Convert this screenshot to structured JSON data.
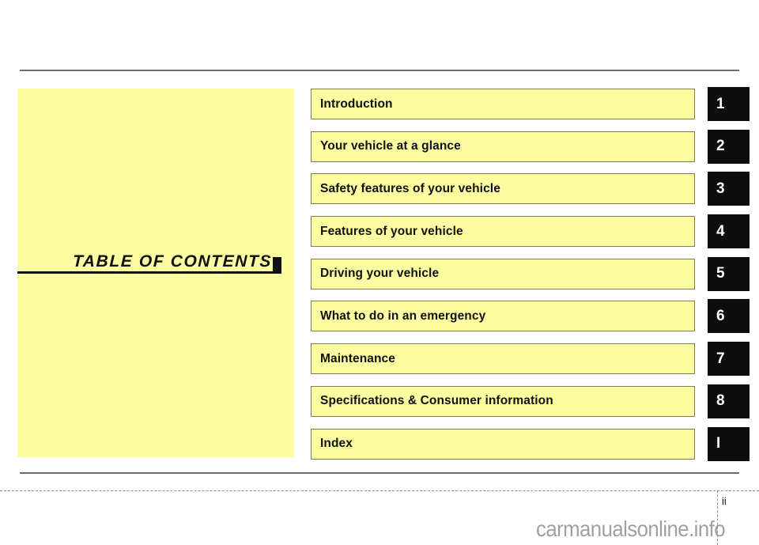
{
  "page": {
    "title": "TABLE OF CONTENTS",
    "page_number": "ii",
    "watermark": "carmanualsonline.info",
    "colors": {
      "panel_yellow": "#fcfca0",
      "box_border": "#7e7d4e",
      "tab_black": "#0d0d0d",
      "rule_gray": "#6e6e6e",
      "watermark_gray": "#a0a0a0"
    }
  },
  "contents": {
    "rows": [
      {
        "label": "Introduction",
        "tab": "1"
      },
      {
        "label": "Your vehicle at a glance",
        "tab": "2"
      },
      {
        "label": "Safety features of your vehicle",
        "tab": "3"
      },
      {
        "label": "Features of your vehicle",
        "tab": "4"
      },
      {
        "label": "Driving your vehicle",
        "tab": "5"
      },
      {
        "label": "What to do in an emergency",
        "tab": "6"
      },
      {
        "label": "Maintenance",
        "tab": "7"
      },
      {
        "label": "Specifications & Consumer information",
        "tab": "8"
      },
      {
        "label": "Index",
        "tab": "I"
      }
    ]
  }
}
